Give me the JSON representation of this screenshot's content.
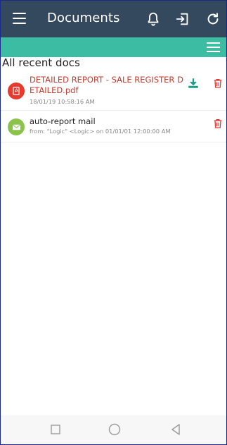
{
  "app": {
    "title": "Documents"
  },
  "section": {
    "title": "All recent docs"
  },
  "documents": [
    {
      "title": "DETAILED REPORT - SALE REGISTER DETAILED.pdf",
      "meta": "18/01/19 10:58:16 AM",
      "icon": "pdf-icon",
      "title_color": "#c0392b",
      "has_download": true
    },
    {
      "title": "auto-report mail",
      "meta": "from: \"Logic\" <Logic> on 01/01/01 12:00:00 AM",
      "icon": "mail-icon",
      "title_color": "#222222",
      "has_download": false
    }
  ],
  "colors": {
    "appbar": "#34495e",
    "accent": "#3cbca2",
    "pdf": "#e8392e",
    "mail": "#8bc34a",
    "delete": "#e53935"
  }
}
